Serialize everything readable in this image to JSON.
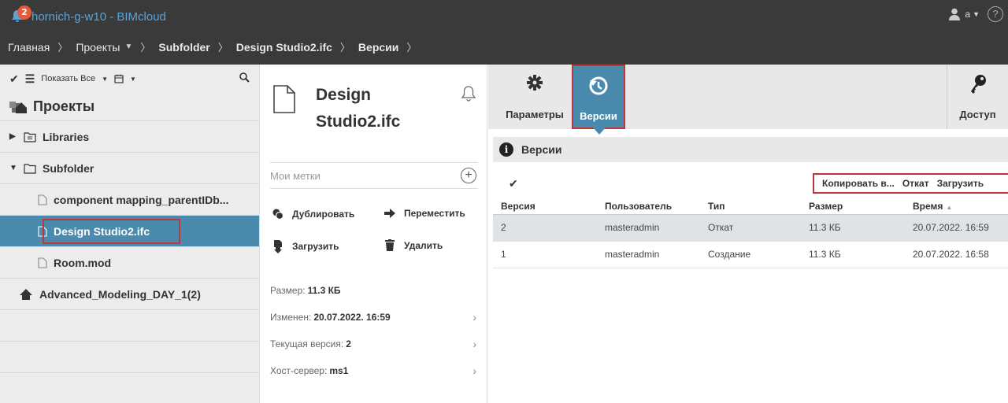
{
  "header": {
    "notification_count": "2",
    "app_title": "hornich-g-w10 - BIMcloud",
    "user_initial": "a",
    "breadcrumb": {
      "home": "Главная",
      "projects": "Проекты",
      "folder": "Subfolder",
      "file": "Design Studio2.ifc",
      "versions": "Версии"
    }
  },
  "left": {
    "toolbar": {
      "show_all": "Показать Все"
    },
    "title": "Проекты",
    "tree": [
      {
        "label": "Libraries"
      },
      {
        "label": "Subfolder"
      },
      {
        "label": "component mapping_parentIDb..."
      },
      {
        "label": "Design Studio2.ifc"
      },
      {
        "label": "Room.mod"
      },
      {
        "label": "Advanced_Modeling_DAY_1(2)"
      }
    ]
  },
  "middle": {
    "title_line1": "Design",
    "title_line2": "Studio2.ifc",
    "tags_placeholder": "Мои метки",
    "actions": {
      "duplicate": "Дублировать",
      "move": "Переместить",
      "download": "Загрузить",
      "delete": "Удалить"
    },
    "props": {
      "size_label": "Размер:",
      "size_value": "11.3 КБ",
      "modified_label": "Изменен:",
      "modified_value": "20.07.2022. 16:59",
      "current_version_label": "Текущая версия:",
      "current_version_value": "2",
      "host_label": "Хост-сервер:",
      "host_value": "ms1"
    }
  },
  "right": {
    "tabs": {
      "params": "Параметры",
      "versions": "Версии",
      "access": "Доступ"
    },
    "section_title": "Версии",
    "actions": {
      "copy": "Копировать в...",
      "rollback": "Откат",
      "download": "Загрузить"
    },
    "columns": {
      "version": "Версия",
      "user": "Пользователь",
      "type": "Тип",
      "size": "Размер",
      "time": "Время"
    },
    "rows": [
      {
        "version": "2",
        "user": "masteradmin",
        "type": "Откат",
        "size": "11.3 КБ",
        "time": "20.07.2022. 16:59"
      },
      {
        "version": "1",
        "user": "masteradmin",
        "type": "Создание",
        "size": "11.3 КБ",
        "time": "20.07.2022. 16:58"
      }
    ]
  },
  "colors": {
    "topbar": "#3a3a3a",
    "accent": "#4a8aad",
    "highlight_outline": "#c0353a",
    "badge": "#e65a3a"
  }
}
